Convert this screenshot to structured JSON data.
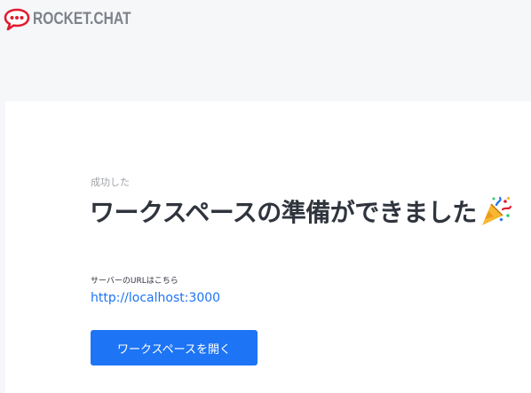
{
  "header": {
    "logo_text": "ROCKET.CHAT",
    "logo_icon": "rocket-chat-logo-icon",
    "brand_color": "#e21c2f"
  },
  "main": {
    "overline": "成功した",
    "title": "ワークスペースの準備ができました",
    "title_icon": "party-popper-icon",
    "url_label": "サーバーのURLはこちら",
    "url": "http://localhost:3000",
    "open_button_label": "ワークスペースを開く"
  },
  "colors": {
    "page_background": "#f6f7f9",
    "card_background": "#ffffff",
    "primary": "#1d74f5",
    "title_text": "#2f343d",
    "muted_text": "#9ea2a8"
  }
}
